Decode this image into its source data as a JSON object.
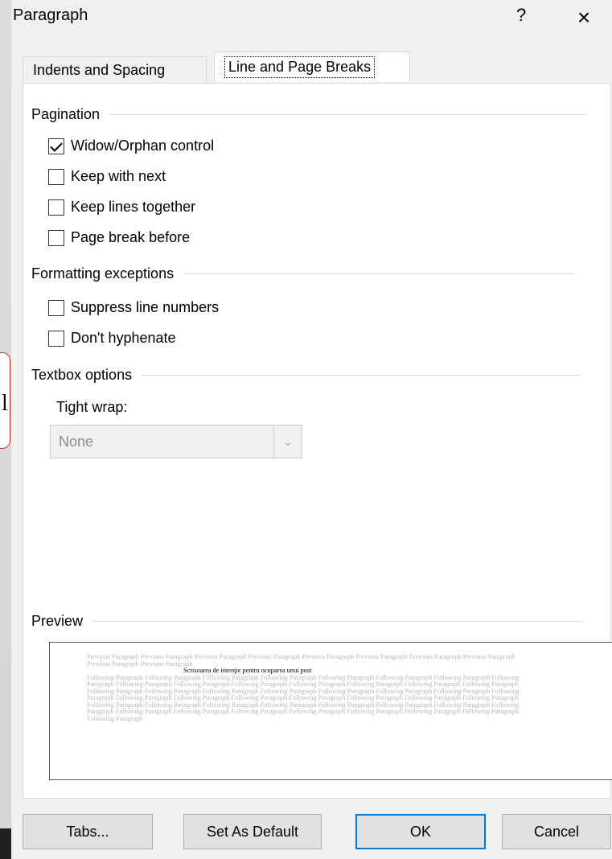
{
  "dialog": {
    "title": "Paragraph",
    "help": "?",
    "close": "×"
  },
  "tabs": [
    {
      "label": "Indents and Spacing",
      "selected": false
    },
    {
      "label": "Line and Page Breaks",
      "selected": true
    }
  ],
  "pagination": {
    "heading": "Pagination",
    "options": [
      {
        "label": "Widow/Orphan control",
        "checked": true
      },
      {
        "label": "Keep with next",
        "checked": false
      },
      {
        "label": "Keep lines together",
        "checked": false
      },
      {
        "label": "Page break before",
        "checked": false
      }
    ]
  },
  "formatting": {
    "heading": "Formatting exceptions",
    "options": [
      {
        "label": "Suppress line numbers",
        "checked": false
      },
      {
        "label": "Don't hyphenate",
        "checked": false
      }
    ]
  },
  "textbox": {
    "heading": "Textbox options",
    "tight_wrap_label": "Tight wrap:",
    "tight_wrap_value": "None"
  },
  "preview": {
    "heading": "Preview",
    "previous_text": "Previous Paragraph Previous Paragraph Previous Paragraph Previous Paragraph Previous Paragraph Previous Paragraph Previous Paragraph Previous Paragraph Previous Paragraph Previous Paragraph",
    "sample_text": "Scrisoarea de intenţie pentru ocuparea unui post",
    "following_text": "Following Paragraph Following Paragraph Following Paragraph Following Paragraph Following Paragraph Following Paragraph Following Paragraph Following Paragraph Following Paragraph Following Paragraph Following Paragraph Following Paragraph Following Paragraph Following Paragraph Following Paragraph Following Paragraph Following Paragraph Following Paragraph Following Paragraph Following Paragraph Following Paragraph Following Paragraph Following Paragraph Following Paragraph Following Paragraph Following Paragraph Following Paragraph Following Paragraph Following Paragraph Following Paragraph Following Paragraph Following Paragraph Following Paragraph Following Paragraph Following Paragraph Following Paragraph Following Paragraph Following Paragraph Following Paragraph Following Paragraph Following Paragraph Following Paragraph Following Paragraph Following Paragraph Following Paragraph Following Paragraph"
  },
  "buttons": {
    "tabs": "Tabs...",
    "set_default": "Set As Default",
    "ok": "OK",
    "cancel": "Cancel"
  },
  "backdrop": {
    "visible_char": "l"
  }
}
